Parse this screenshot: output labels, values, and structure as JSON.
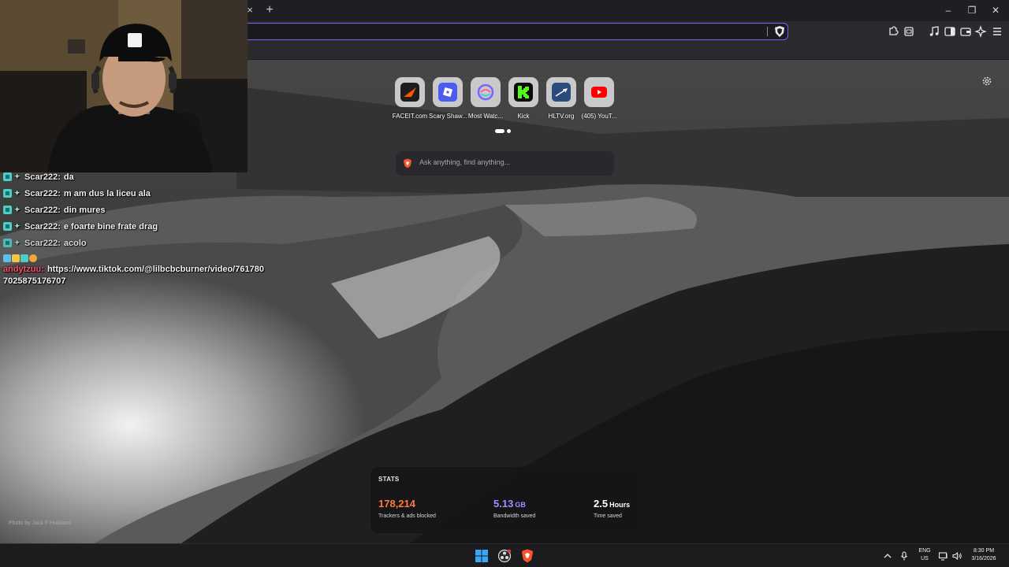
{
  "browser": {
    "tab_close": "×",
    "new_tab": "+",
    "window_controls": {
      "minimize": "–",
      "restore": "❐",
      "close": "✕"
    },
    "toolbar_icons": [
      "extensions-icon",
      "tab-search-icon",
      "media-icon",
      "sidebar-icon",
      "wallet-icon",
      "leo-ai-icon",
      "menu-icon"
    ],
    "accent_color": "#7c5cff"
  },
  "chat": {
    "messages": [
      {
        "user": "Scar222:",
        "text": "da"
      },
      {
        "user": "Scar222:",
        "text": "m am dus la liceu ala"
      },
      {
        "user": "Scar222:",
        "text": "din mures"
      },
      {
        "user": "Scar222:",
        "text": "e foarte bine frate drag"
      },
      {
        "user": "Scar222:",
        "text": "acolo"
      }
    ],
    "link_message": {
      "user": "andytzuu:",
      "text_line1": "https://www.tiktok.com/@lilbcbcburner/video/761780",
      "text_line2": "7025875176707"
    }
  },
  "shortcuts": [
    {
      "label": "FACEIT.com",
      "icon": "faceit-icon"
    },
    {
      "label": "Scary Shaw...",
      "icon": "roblox-icon"
    },
    {
      "label": "Most Watc...",
      "icon": "twitch-tracker-icon"
    },
    {
      "label": "Kick",
      "icon": "kick-icon"
    },
    {
      "label": "HLTV.org",
      "icon": "hltv-icon"
    },
    {
      "label": "(405) YouT...",
      "icon": "youtube-icon"
    }
  ],
  "search": {
    "placeholder": "Ask anything, find anything..."
  },
  "stats": {
    "title": "STATS",
    "trackers": {
      "value": "178,214",
      "label": "Trackers & ads blocked",
      "color": "#ff7a3d"
    },
    "bandwidth": {
      "value": "5.13",
      "unit": "GB",
      "label": "Bandwidth saved",
      "color": "#a88cff"
    },
    "time": {
      "value": "2.5",
      "unit": "Hours",
      "label": "Time saved",
      "color": "#ffffff"
    }
  },
  "photo_credit": "Photo by Jack F Hubbard",
  "taskbar": {
    "apps": [
      "windows-start-icon",
      "obs-icon",
      "brave-icon"
    ],
    "tray": {
      "lang_line1": "ENG",
      "lang_line2": "US",
      "time": "8:30 PM",
      "date": "3/16/2026"
    }
  }
}
